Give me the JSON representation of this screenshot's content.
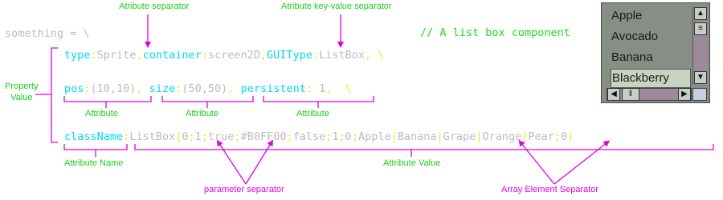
{
  "code": {
    "line1_start": "something = \\",
    "comment": "// A list box component",
    "type_key": "type",
    "type_val": "Sprite",
    "container_key": "container",
    "container_val": "screen2D",
    "guitype_key": "GUIType",
    "guitype_val": "ListBox",
    "pos_key": "pos",
    "pos_val": "(10,10)",
    "size_key": "size",
    "size_val": "(50,50)",
    "persistent_key": "persistent",
    "persistent_val": "1",
    "classname_key": "className",
    "classname_func": "ListBox",
    "classname_params": [
      "0",
      "1",
      "true",
      "#B0FF00",
      "false",
      "1",
      "0"
    ],
    "array_items": [
      "Apple",
      "Banana",
      "Grape",
      "Orange",
      "Pear"
    ],
    "colon": ":",
    "comma": ",",
    "backslash": "\\",
    "semicolon": ";",
    "open_paren": "(",
    "close_paren": ")",
    "pipe": "|"
  },
  "annotations": {
    "attribute_separator": "Atribute separator",
    "key_value_separator": "Atribute key-value separator",
    "property_value": "Property\nValue",
    "attribute_1": "Attribute",
    "attribute_2": "Attribute",
    "attribute_3": "Attribute",
    "attribute_name": "Attribute Name",
    "attribute_value": "Attribute Value",
    "parameter_separator": "parameter separator",
    "array_element_separator": "Array Element Separator"
  },
  "listbox": {
    "items": [
      "Apple",
      "Avocado",
      "Banana",
      "Blackberry"
    ],
    "selected_index": 3
  },
  "colors": {
    "keys": "#00d8ee",
    "separators": "#f2e81a",
    "values": "#bcbcbc",
    "comment": "#22d822",
    "annotation_text": "#1fcb1f",
    "annotation_lines": "#e000e0"
  }
}
